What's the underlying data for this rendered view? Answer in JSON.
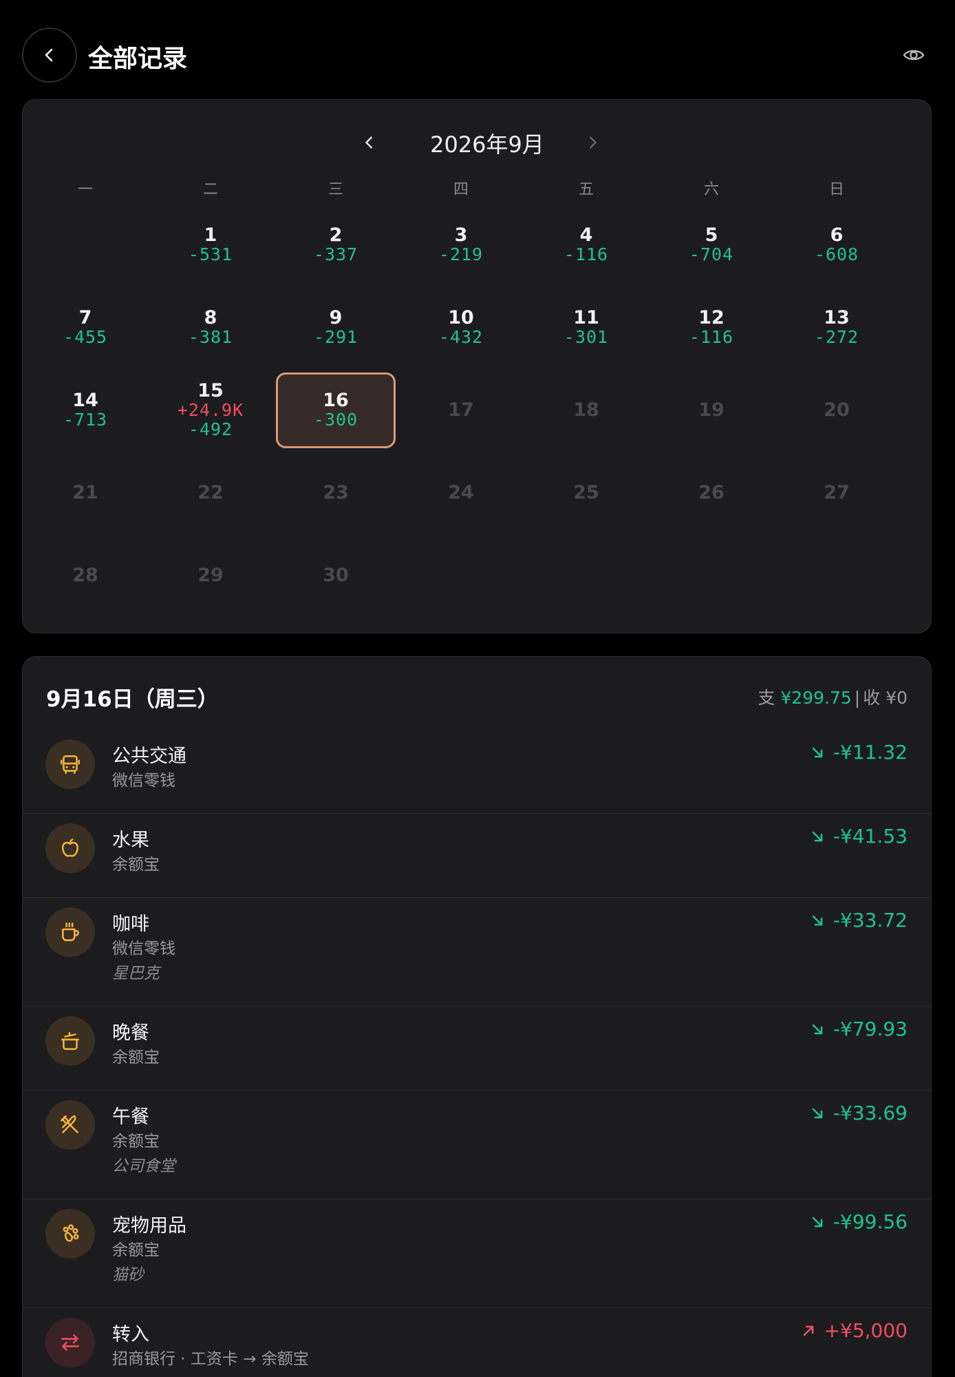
{
  "header": {
    "title": "全部记录"
  },
  "calendar": {
    "month_label": "2026年9月",
    "weekdays": [
      "一",
      "二",
      "三",
      "四",
      "五",
      "六",
      "日"
    ],
    "days": [
      {
        "day": "1",
        "col": 1,
        "row": 0,
        "amounts": [
          {
            "v": "-531",
            "t": "neg"
          }
        ]
      },
      {
        "day": "2",
        "col": 2,
        "row": 0,
        "amounts": [
          {
            "v": "-337",
            "t": "neg"
          }
        ]
      },
      {
        "day": "3",
        "col": 3,
        "row": 0,
        "amounts": [
          {
            "v": "-219",
            "t": "neg"
          }
        ]
      },
      {
        "day": "4",
        "col": 4,
        "row": 0,
        "amounts": [
          {
            "v": "-116",
            "t": "neg"
          }
        ]
      },
      {
        "day": "5",
        "col": 5,
        "row": 0,
        "amounts": [
          {
            "v": "-704",
            "t": "neg"
          }
        ]
      },
      {
        "day": "6",
        "col": 6,
        "row": 0,
        "amounts": [
          {
            "v": "-608",
            "t": "neg"
          }
        ]
      },
      {
        "day": "7",
        "col": 0,
        "row": 1,
        "amounts": [
          {
            "v": "-455",
            "t": "neg"
          }
        ]
      },
      {
        "day": "8",
        "col": 1,
        "row": 1,
        "amounts": [
          {
            "v": "-381",
            "t": "neg"
          }
        ]
      },
      {
        "day": "9",
        "col": 2,
        "row": 1,
        "amounts": [
          {
            "v": "-291",
            "t": "neg"
          }
        ]
      },
      {
        "day": "10",
        "col": 3,
        "row": 1,
        "amounts": [
          {
            "v": "-432",
            "t": "neg"
          }
        ]
      },
      {
        "day": "11",
        "col": 4,
        "row": 1,
        "amounts": [
          {
            "v": "-301",
            "t": "neg"
          }
        ]
      },
      {
        "day": "12",
        "col": 5,
        "row": 1,
        "amounts": [
          {
            "v": "-116",
            "t": "neg"
          }
        ]
      },
      {
        "day": "13",
        "col": 6,
        "row": 1,
        "amounts": [
          {
            "v": "-272",
            "t": "neg"
          }
        ]
      },
      {
        "day": "14",
        "col": 0,
        "row": 2,
        "amounts": [
          {
            "v": "-713",
            "t": "neg"
          }
        ]
      },
      {
        "day": "15",
        "col": 1,
        "row": 2,
        "amounts": [
          {
            "v": "+24.9K",
            "t": "pos"
          },
          {
            "v": "-492",
            "t": "neg"
          }
        ]
      },
      {
        "day": "16",
        "col": 2,
        "row": 2,
        "selected": true,
        "amounts": [
          {
            "v": "-300",
            "t": "neg"
          }
        ]
      },
      {
        "day": "17",
        "col": 3,
        "row": 2,
        "future": true,
        "amounts": []
      },
      {
        "day": "18",
        "col": 4,
        "row": 2,
        "future": true,
        "amounts": []
      },
      {
        "day": "19",
        "col": 5,
        "row": 2,
        "future": true,
        "amounts": []
      },
      {
        "day": "20",
        "col": 6,
        "row": 2,
        "future": true,
        "amounts": []
      },
      {
        "day": "21",
        "col": 0,
        "row": 3,
        "future": true,
        "amounts": []
      },
      {
        "day": "22",
        "col": 1,
        "row": 3,
        "future": true,
        "amounts": []
      },
      {
        "day": "23",
        "col": 2,
        "row": 3,
        "future": true,
        "amounts": []
      },
      {
        "day": "24",
        "col": 3,
        "row": 3,
        "future": true,
        "amounts": []
      },
      {
        "day": "25",
        "col": 4,
        "row": 3,
        "future": true,
        "amounts": []
      },
      {
        "day": "26",
        "col": 5,
        "row": 3,
        "future": true,
        "amounts": []
      },
      {
        "day": "27",
        "col": 6,
        "row": 3,
        "future": true,
        "amounts": []
      },
      {
        "day": "28",
        "col": 0,
        "row": 4,
        "future": true,
        "amounts": []
      },
      {
        "day": "29",
        "col": 1,
        "row": 4,
        "future": true,
        "amounts": []
      },
      {
        "day": "30",
        "col": 2,
        "row": 4,
        "future": true,
        "amounts": []
      }
    ]
  },
  "detail": {
    "date_label": "9月16日（周三）",
    "summary": {
      "expense_prefix": "支",
      "expense": "¥299.75",
      "separator": "|",
      "income_prefix": "收",
      "income": "¥0"
    },
    "transactions": [
      {
        "title": "公共交通",
        "sub": "微信零钱",
        "note": "",
        "amount": "-¥11.32",
        "type": "neg",
        "icon": "bus-icon"
      },
      {
        "title": "水果",
        "sub": "余额宝",
        "note": "",
        "amount": "-¥41.53",
        "type": "neg",
        "icon": "apple-icon"
      },
      {
        "title": "咖啡",
        "sub": "微信零钱",
        "note": "星巴克",
        "amount": "-¥33.72",
        "type": "neg",
        "icon": "coffee-icon"
      },
      {
        "title": "晚餐",
        "sub": "余额宝",
        "note": "",
        "amount": "-¥79.93",
        "type": "neg",
        "icon": "pot-icon"
      },
      {
        "title": "午餐",
        "sub": "余额宝",
        "note": "公司食堂",
        "amount": "-¥33.69",
        "type": "neg",
        "icon": "utensils-icon"
      },
      {
        "title": "宠物用品",
        "sub": "余额宝",
        "note": "猫砂",
        "amount": "-¥99.56",
        "type": "neg",
        "icon": "paw-icon"
      },
      {
        "title": "转入",
        "sub": "招商银行 · 工资卡 → 余额宝",
        "note": "",
        "amount": "+¥5,000",
        "type": "pos",
        "icon": "transfer-icon"
      }
    ]
  },
  "colors": {
    "expense": "#1fc48a",
    "income": "#f04d5e",
    "accent": "#d89a76",
    "icon_fg": "#f2b43a"
  }
}
